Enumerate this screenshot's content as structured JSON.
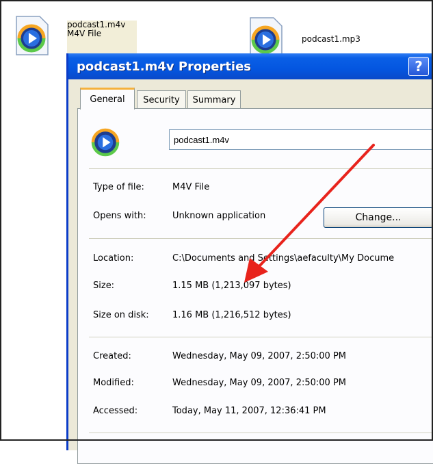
{
  "desktop": {
    "file1": {
      "name": "podcast1.m4v",
      "type": "M4V File"
    },
    "file2": {
      "name": "podcast1.mp3"
    }
  },
  "dialog": {
    "title": "podcast1.m4v Properties",
    "help_label": "?",
    "tabs": [
      {
        "label": "General",
        "active": true
      },
      {
        "label": "Security",
        "active": false
      },
      {
        "label": "Summary",
        "active": false
      }
    ],
    "filename": "podcast1.m4v",
    "type_label": "Type of file:",
    "type_value": "M4V File",
    "opens_label": "Opens with:",
    "opens_value": "Unknown application",
    "change_label": "Change...",
    "location_label": "Location:",
    "location_value": "C:\\Documents and Settings\\aefaculty\\My Docume",
    "size_label": "Size:",
    "size_value": "1.15 MB (1,213,097 bytes)",
    "sizedisk_label": "Size on disk:",
    "sizedisk_value": "1.16 MB (1,216,512 bytes)",
    "created_label": "Created:",
    "created_value": "Wednesday, May 09, 2007, 2:50:00 PM",
    "modified_label": "Modified:",
    "modified_value": "Wednesday, May 09, 2007, 2:50:00 PM",
    "accessed_label": "Accessed:",
    "accessed_value": "Today, May 11, 2007, 12:36:41 PM"
  },
  "colors": {
    "titlebar": "#0456e0",
    "dialog_bg": "#ece9d8",
    "annotation_arrow": "#e8231c"
  },
  "icons": {
    "file_icon": "windows-media-player-icon",
    "help_icon": "help-icon"
  }
}
